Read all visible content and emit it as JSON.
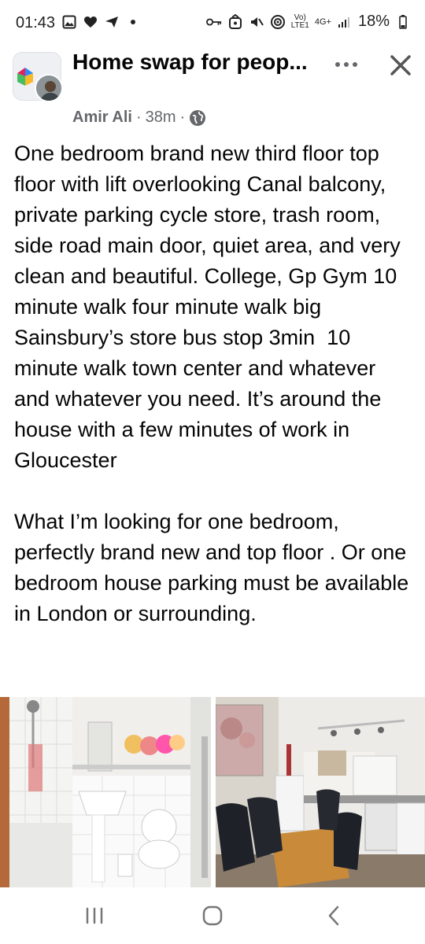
{
  "status_bar": {
    "time": "01:43",
    "network_label_top": "Vo)",
    "network_label_bottom": "LTE1",
    "data_type": "4G+",
    "battery": "18%"
  },
  "post": {
    "group_name": "Home swap for peop...",
    "author": "Amir Ali",
    "separator": "·",
    "time": "38m",
    "body": "One bedroom brand new third floor top floor with lift overlooking Canal balcony, private parking cycle store, trash room, side road main door, quiet area, and very clean and beautiful. College, Gp Gym 10 minute walk four minute walk big Sainsbury’s store bus stop 3min  10 minute walk town center and whatever and whatever you need. It’s around the house with a few minutes of work in Gloucester\n\nWhat I’m looking for one bedroom, perfectly brand new and top floor . Or one bedroom house parking must be available in London or surrounding."
  },
  "icons": {
    "audience": "globe-icon",
    "more": "more-options-icon",
    "close": "close-icon"
  },
  "colors": {
    "text": "#050505",
    "secondary": "#65676b",
    "background": "#ffffff"
  }
}
